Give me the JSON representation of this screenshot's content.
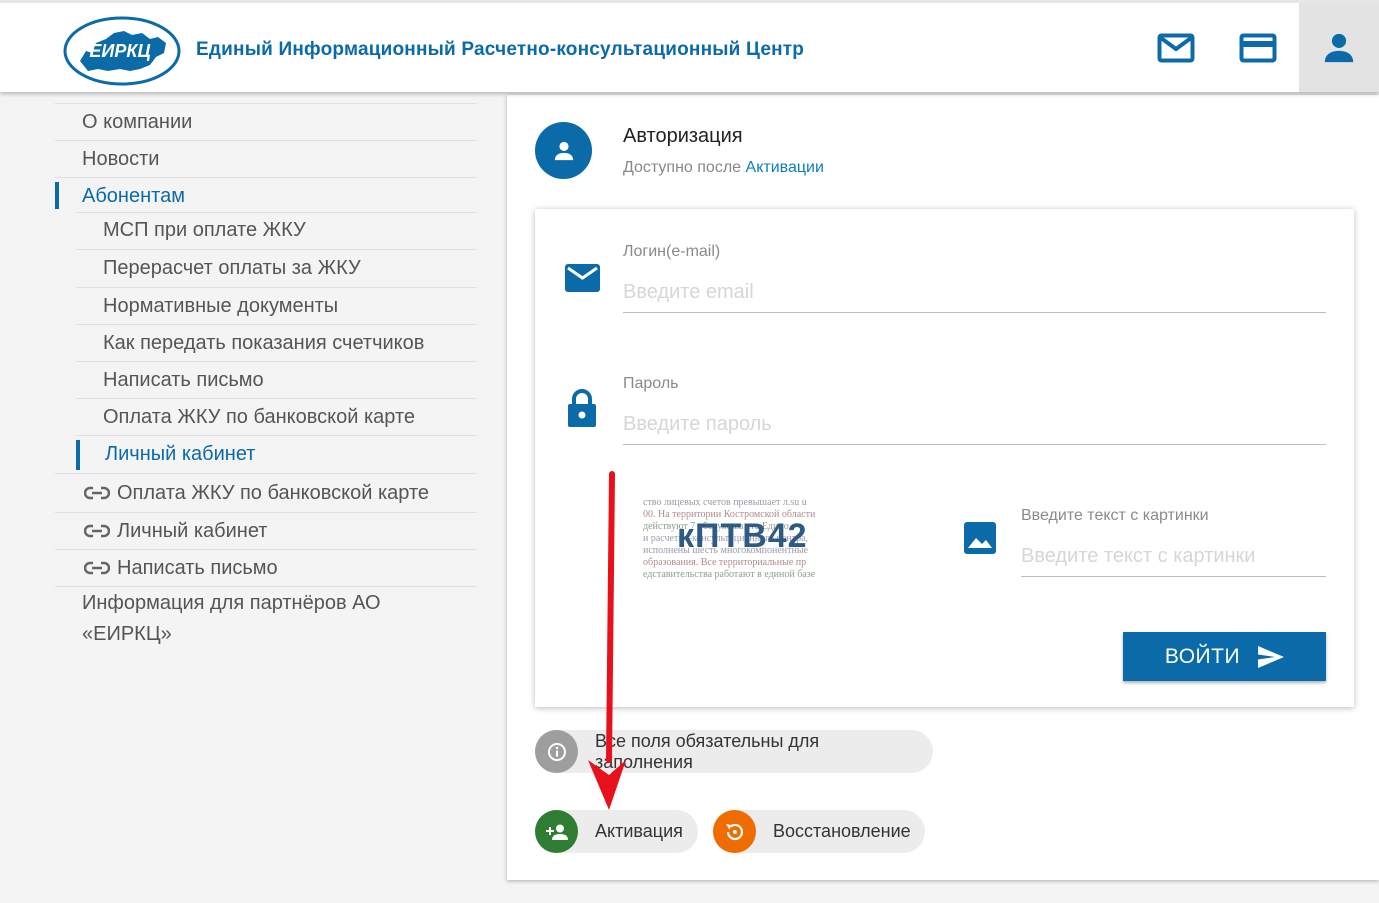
{
  "header": {
    "logo_text": "ЕИРКЦ",
    "brand_name": "Единый Информационный Расчетно-консультационный Центр",
    "icons": [
      "mail-icon",
      "credit-card-icon",
      "user-icon"
    ],
    "accent_color": "#0b6aa8"
  },
  "sidebar": {
    "about": "О компании",
    "news": "Новости",
    "subscribers": "Абонентам",
    "sub_items": [
      "МСП при оплате ЖКУ",
      "Перерасчет оплаты за ЖКУ",
      "Нормативные документы",
      "Как передать показания счетчиков",
      "Написать письмо",
      "Оплата ЖКУ по банковской карте",
      "Личный кабинет"
    ],
    "links": [
      "Оплата ЖКУ по банковской карте",
      "Личный кабинет",
      "Написать письмо"
    ],
    "partners": "Информация для партнёров АО «ЕИРКЦ»"
  },
  "auth": {
    "title": "Авторизация",
    "subtitle_prefix": "Доступно после ",
    "subtitle_link": "Активации",
    "login_label": "Логин(e-mail)",
    "login_placeholder": "Введите email",
    "password_label": "Пароль",
    "password_placeholder": "Введите пароль",
    "captcha_code": "кПТВ42",
    "captcha_noise": [
      "ство лицевых счетов превышает  л.su u",
      "00. На территории Костромской области",
      "действуют 7 обслужива  ета Едино",
      "и расчетно-консультационного центра,",
      "исполнены шесть многокомпонентные",
      "образования. Все территориальные пр",
      "едставительства работают в единой базе"
    ],
    "captcha_label": "Введите текст с картинки",
    "captcha_placeholder": "Введите текст с картинки",
    "login_button": "ВОЙТИ",
    "required_notice": "Все поля обязательны для заполнения",
    "activation_button": "Активация",
    "restore_button": "Восстановление"
  },
  "colors": {
    "activation": "#2e7d32",
    "restore": "#ef6c00",
    "info": "#9e9e9e",
    "annotation_arrow": "#e8101a"
  }
}
